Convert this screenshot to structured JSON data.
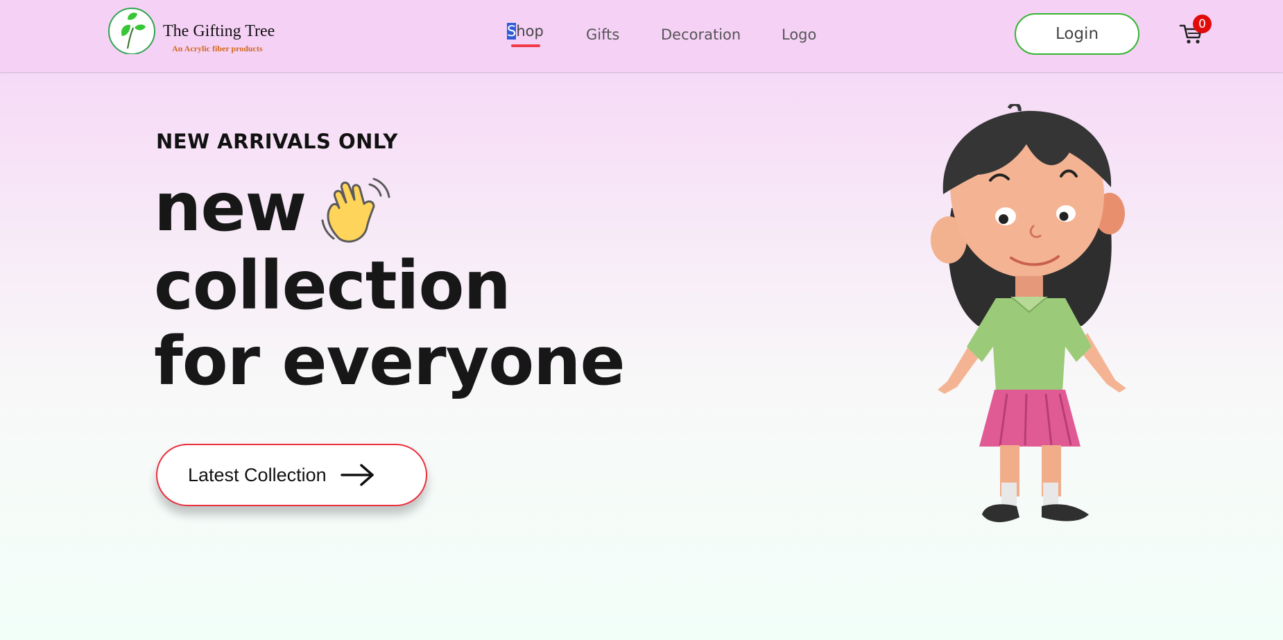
{
  "brand": {
    "name": "The Gifting Tree",
    "tagline": "An Acrylic fiber products"
  },
  "nav": {
    "items": [
      {
        "label": "Shop",
        "selected_part": "S",
        "rest": "hop",
        "active": true
      },
      {
        "label": "Gifts"
      },
      {
        "label": "Decoration"
      },
      {
        "label": "Logo"
      }
    ]
  },
  "header": {
    "login_label": "Login",
    "cart_count": "0"
  },
  "hero": {
    "kicker": "NEW ARRIVALS ONLY",
    "title_lines": [
      "new",
      "collection",
      "for everyone"
    ],
    "cta_label": "Latest Collection"
  },
  "colors": {
    "nav_bg": "#f5d1f6",
    "accent_red": "#ef3b4a",
    "login_border": "#31b52f",
    "cart_badge": "#e10b0b"
  },
  "icons": [
    "leaf-logo-icon",
    "shopping-cart-icon",
    "waving-hand-icon",
    "arrow-right-icon",
    "girl-illustration"
  ]
}
